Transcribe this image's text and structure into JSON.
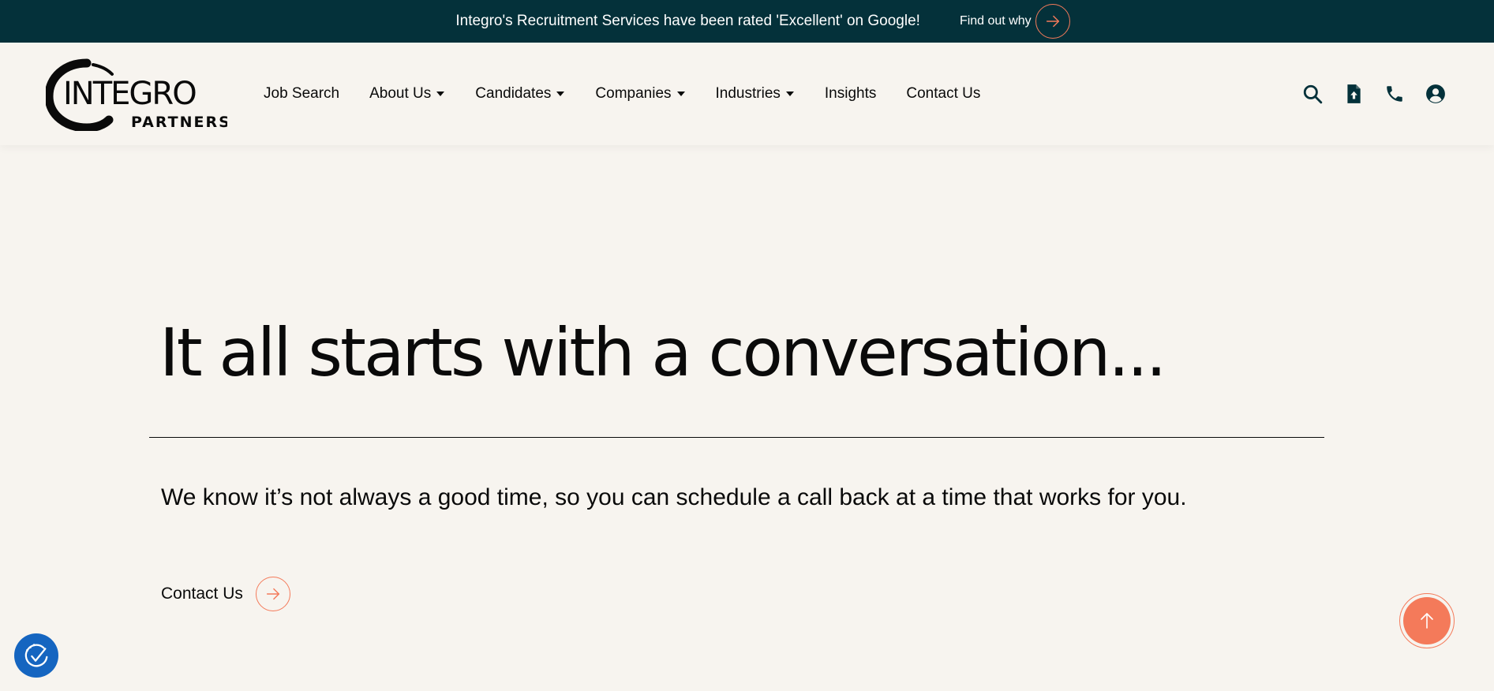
{
  "announcement": {
    "text": "Integro's Recruitment Services have been rated 'Excellent' on Google!",
    "link_label": "Find out why"
  },
  "header": {
    "logo": {
      "main": "INTEGRO",
      "sub": "PARTNERS"
    },
    "nav": [
      {
        "label": "Job Search",
        "dropdown": false
      },
      {
        "label": "About Us",
        "dropdown": true
      },
      {
        "label": "Candidates",
        "dropdown": true
      },
      {
        "label": "Companies",
        "dropdown": true
      },
      {
        "label": "Industries",
        "dropdown": true
      },
      {
        "label": "Insights",
        "dropdown": false
      },
      {
        "label": "Contact Us",
        "dropdown": false
      }
    ],
    "icons": [
      "search-icon",
      "upload-cv-icon",
      "phone-icon",
      "account-icon"
    ]
  },
  "hero": {
    "title": "It all starts with a conversation...",
    "body": "We know it’s not always a good time, so you can schedule a call back at a time that works for you.",
    "cta_label": "Contact Us"
  },
  "colors": {
    "announce_bg": "#04313a",
    "page_bg": "#f7f4ef",
    "accent": "#f47a5a",
    "icon_dark": "#04313a",
    "accessibility_bg": "#1565c0"
  }
}
